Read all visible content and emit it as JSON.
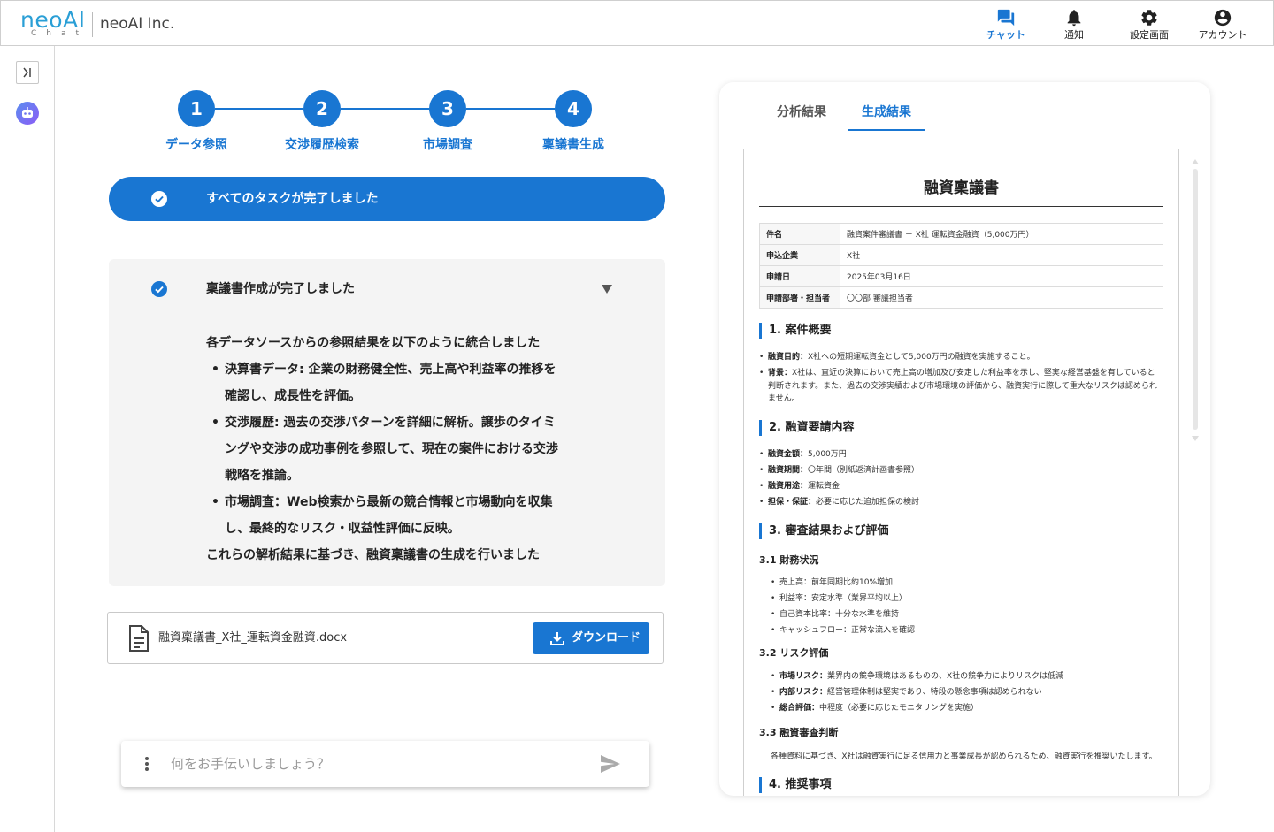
{
  "header": {
    "logo_text": "neoAI",
    "logo_sub": "Chat",
    "company": "neoAI Inc.",
    "nav": [
      {
        "label": "チャット",
        "icon": "chat-icon",
        "active": true
      },
      {
        "label": "通知",
        "icon": "bell-icon",
        "active": false
      },
      {
        "label": "設定画面",
        "icon": "gear-icon",
        "active": false
      },
      {
        "label": "アカウント",
        "icon": "account-icon",
        "active": false
      }
    ]
  },
  "sidebar": {
    "collapse_icon": "expand-sidebar-icon",
    "assistant_icon": "bot-icon"
  },
  "stepper": {
    "steps": [
      {
        "number": "1",
        "label": "データ参照"
      },
      {
        "number": "2",
        "label": "交渉履歴検索"
      },
      {
        "number": "3",
        "label": "市場調査"
      },
      {
        "number": "4",
        "label": "稟議書生成"
      }
    ]
  },
  "status_banner": {
    "text": "すべてのタスクが完了しました"
  },
  "result": {
    "title": "稟議書作成が完了しました",
    "intro": "各データソースからの参照結果を以下のように統合しました",
    "bullets": [
      "決算書データ: 企業の財務健全性、売上高や利益率の推移を確認し、成長性を評価。",
      "交渉履歴: 過去の交渉パターンを詳細に解析。譲歩のタイミングや交渉の成功事例を参照して、現在の案件における交渉戦略を推論。",
      "市場調査：Web検索から最新の競合情報と市場動向を収集し、最終的なリスク・収益性評価に反映。"
    ],
    "conclusion": "これらの解析結果に基づき、融資稟議書の生成を行いました"
  },
  "file": {
    "name": "融資稟議書_X社_運転資金融資.docx",
    "download_label": "ダウンロード"
  },
  "chat_input": {
    "placeholder": "何をお手伝いしましょう？",
    "value": ""
  },
  "panel": {
    "tabs": [
      {
        "label": "分析結果",
        "active": false
      },
      {
        "label": "生成結果",
        "active": true
      }
    ],
    "doc": {
      "title": "融資稟議書",
      "info": [
        {
          "key": "件名",
          "value": "融資案件審議書 － X社 運転資金融資（5,000万円）"
        },
        {
          "key": "申込企業",
          "value": "X社"
        },
        {
          "key": "申請日",
          "value": "2025年03月16日"
        },
        {
          "key": "申請部署・担当者",
          "value": "〇〇部 審議担当者"
        }
      ],
      "sections": {
        "s1": {
          "title": "1. 案件概要",
          "items": [
            {
              "label": "融資目的：",
              "text": "X社への短期運転資金として5,000万円の融資を実施すること。"
            },
            {
              "label": "背景：",
              "text": "X社は、直近の決算において売上高の増加及び安定した利益率を示し、堅実な経営基盤を有していると判断されます。また、過去の交渉実績および市場環境の評価から、融資実行に際して重大なリスクは認められません。"
            }
          ]
        },
        "s2": {
          "title": "2. 融資要請内容",
          "items": [
            {
              "label": "融資金額：",
              "text": "5,000万円"
            },
            {
              "label": "融資期間：",
              "text": "〇年間（別紙返済計画書参照）"
            },
            {
              "label": "融資用途：",
              "text": "運転資金"
            },
            {
              "label": "担保・保証：",
              "text": "必要に応じた追加担保の検討"
            }
          ]
        },
        "s3": {
          "title": "3. 審査結果および評価",
          "sub1": {
            "title": "3.1 財務状況",
            "items": [
              "売上高：前年同期比約10%増加",
              "利益率：安定水準（業界平均以上）",
              "自己資本比率：十分な水準を維持",
              "キャッシュフロー：正常な流入を確認"
            ]
          },
          "sub2": {
            "title": "3.2 リスク評価",
            "items": [
              {
                "label": "市場リスク：",
                "text": "業界内の競争環境はあるものの、X社の競争力によりリスクは低減"
              },
              {
                "label": "内部リスク：",
                "text": "経営管理体制は堅実であり、特段の懸念事項は認められない"
              },
              {
                "label": "総合評価：",
                "text": "中程度（必要に応じたモニタリングを実施）"
              }
            ]
          },
          "sub3": {
            "title": "3.3 融資審査判断",
            "text": "各種資料に基づき、X社は融資実行に足る信用力と事業成長が認められるため、融資実行を推奨いたします。"
          }
        },
        "s4": {
          "title": "4. 推奨事項"
        }
      }
    }
  },
  "colors": {
    "primary": "#1976d2",
    "logo": "#2a9fd6",
    "card_bg": "#f4f4f4"
  }
}
